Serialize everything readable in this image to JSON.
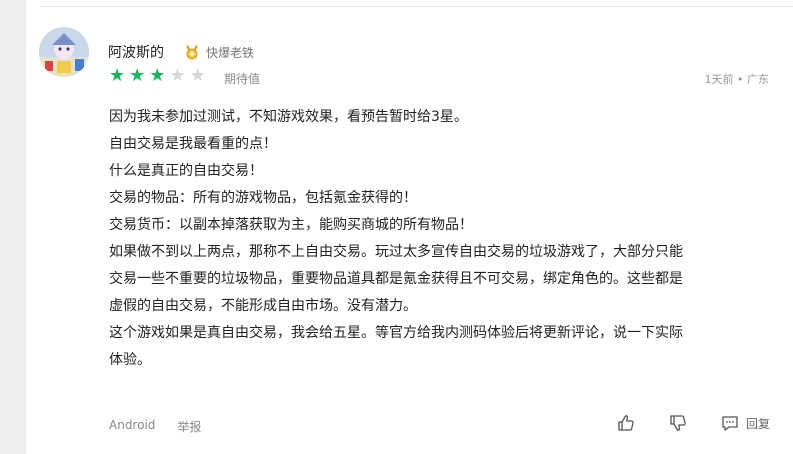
{
  "review": {
    "username": "阿波斯的",
    "badge": "快爆老铁",
    "stars_filled": 3,
    "stars_total": 5,
    "rating_label": "期待值",
    "meta": "1天前 • 广东",
    "lines": [
      "因为我未参加过测试，不知游戏效果，看预告暂时给3星。",
      "自由交易是我最看重的点！",
      "什么是真正的自由交易！",
      "交易的物品：所有的游戏物品，包括氪金获得的！",
      "交易货币：以副本掉落获取为主，能购买商城的所有物品！",
      "如果做不到以上两点，那称不上自由交易。玩过太多宣传自由交易的垃圾游戏了，大部分只能",
      "交易一些不重要的垃圾物品，重要物品道具都是氪金获得且不可交易，绑定角色的。这些都是",
      "虚假的自由交易，不能形成自由市场。没有潜力。",
      "这个游戏如果是真自由交易，我会给五星。等官方给我内测码体验后将更新评论，说一下实际",
      "体验。"
    ],
    "device": "Android",
    "report": "举报",
    "reply": "回复"
  },
  "colors": {
    "star_filled": "#18b55e",
    "star_empty": "#d8d8d8",
    "badge_gold": "#e2a720"
  },
  "icons": {
    "like": "thumbs-up-icon",
    "dislike": "thumbs-down-icon",
    "reply": "comment-icon",
    "badge": "medal-icon"
  }
}
